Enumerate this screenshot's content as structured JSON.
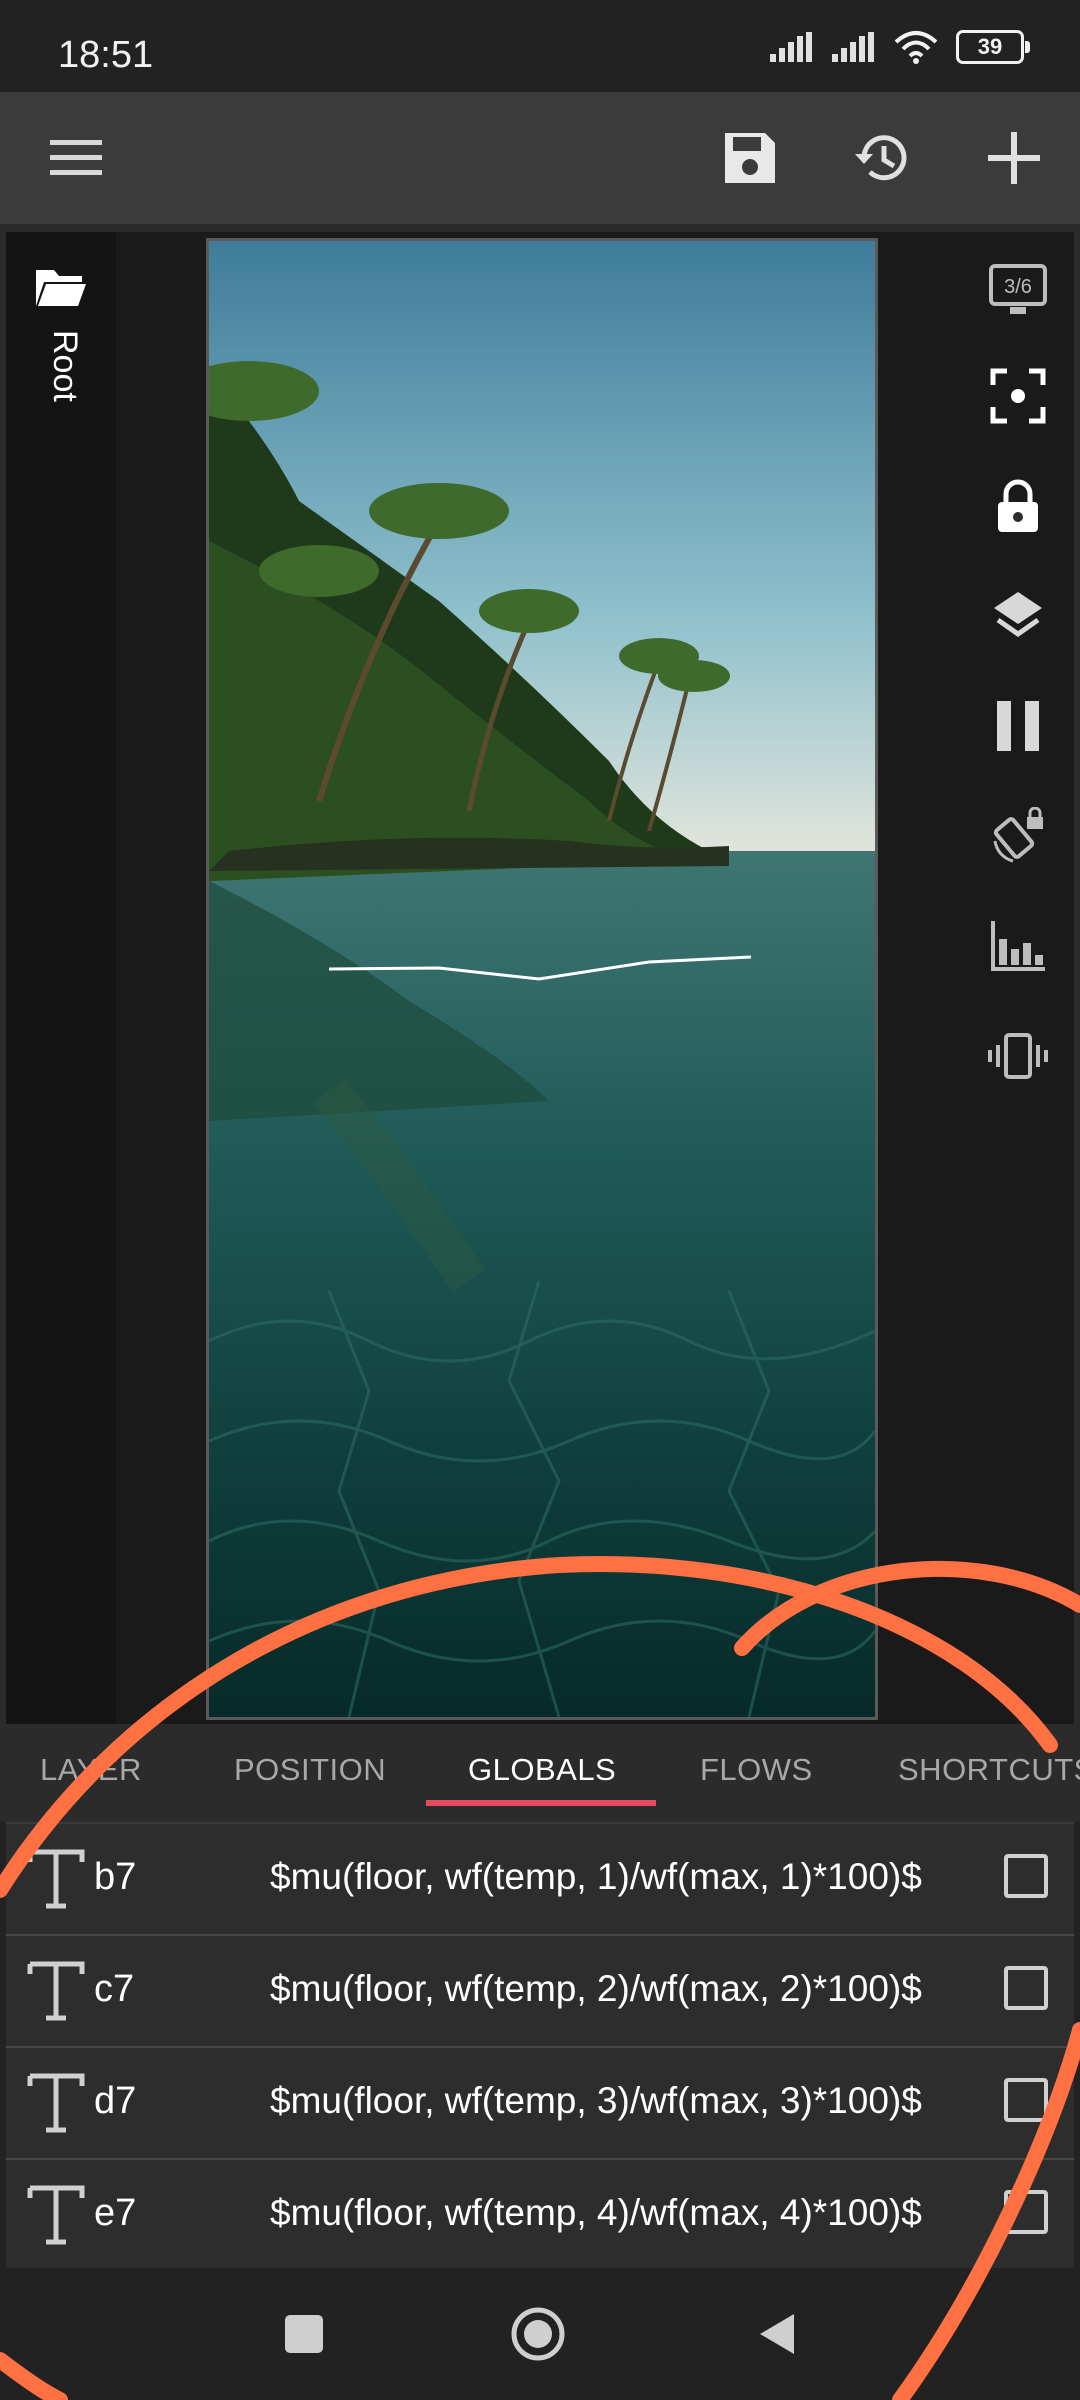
{
  "status_bar": {
    "time": "18:51",
    "battery": "39",
    "icons": [
      "signal-icon",
      "signal-icon",
      "wifi-icon",
      "battery-icon"
    ]
  },
  "app_bar": {
    "icons": [
      "menu-icon",
      "save-icon",
      "history-icon",
      "add-icon"
    ]
  },
  "left_panel": {
    "root_label": "Root",
    "icon": "folder-icon"
  },
  "right_toolbar": {
    "preview_counter": "3/6",
    "icons": [
      "preview-screen-icon",
      "focus-icon",
      "lock-icon",
      "layers-icon",
      "pause-icon",
      "rotation-lock-icon",
      "chart-icon",
      "vibrate-icon"
    ]
  },
  "tabs": [
    "LAYER",
    "POSITION",
    "GLOBALS",
    "FLOWS",
    "SHORTCUTS"
  ],
  "active_tab": "GLOBALS",
  "globals": [
    {
      "name": "b7",
      "formula": "$mu(floor, wf(temp, 1)/wf(max, 1)*100)$",
      "checked": false
    },
    {
      "name": "c7",
      "formula": "$mu(floor, wf(temp, 2)/wf(max, 2)*100)$",
      "checked": false
    },
    {
      "name": "d7",
      "formula": "$mu(floor, wf(temp, 3)/wf(max, 3)*100)$",
      "checked": false
    },
    {
      "name": "e7",
      "formula": "$mu(floor, wf(temp, 4)/wf(max, 4)*100)$",
      "checked": false
    }
  ],
  "nav_bar": {
    "icons": [
      "recents-icon",
      "home-icon",
      "back-icon"
    ]
  },
  "colors": {
    "accent": "#e64a5f",
    "annotation": "#ff7043",
    "app_bar": "#3b3b3b",
    "background": "#222222"
  }
}
